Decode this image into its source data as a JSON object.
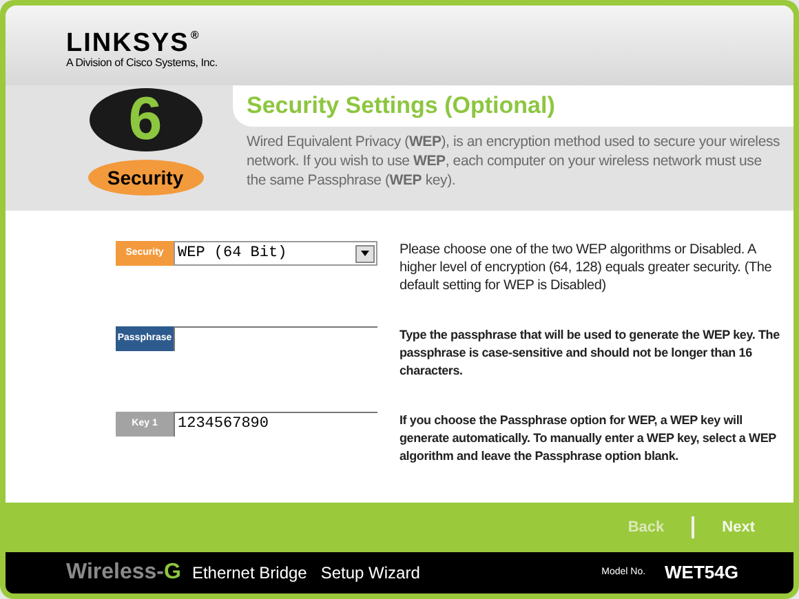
{
  "logo": {
    "name": "LINKSYS",
    "mark": "®",
    "subtitle": "A Division of Cisco Systems, Inc."
  },
  "step": {
    "number": "6",
    "label": "Security"
  },
  "title": "Security Settings (Optional)",
  "intro": "Wired Equivalent Privacy (**WEP**), is an encryption method used to secure your wireless network.  If you wish to use **WEP**, each computer on your wireless network must use the same Passphrase (**WEP** key).",
  "fields": [
    {
      "kind": "select",
      "label": "Security",
      "color": "#f39a3c",
      "value": "WEP (64 Bit)",
      "help": "Please choose one of the two WEP algorithms or Disabled. A higher level of encryption (64, 128) equals greater security. (The default setting for WEP is Disabled)",
      "help_bold": false
    },
    {
      "kind": "text",
      "label": "Passphrase",
      "color": "#2e5b8e",
      "help": "Type the passphrase that will be used to generate the WEP key. The passphrase is case-sensitive and should not be longer than 16 characters.",
      "help_bold": true
    },
    {
      "kind": "text",
      "label": "Key 1",
      "color": "#a3a3a3",
      "value": "1234567890",
      "help": "If you choose the Passphrase option for WEP, a WEP key will generate automatically. To manually enter a WEP key, select a WEP algorithm and leave the Passphrase option blank.",
      "help_bold": true
    }
  ],
  "nav": [
    {
      "label": "Back",
      "disabled": true
    },
    {
      "label": "Next",
      "disabled": false
    }
  ],
  "footer": {
    "brand": "Wireless-",
    "brand_accent": "G",
    "product": "Ethernet Bridge",
    "wizard": "Setup Wizard",
    "model_label": "Model No.",
    "model": "WET54G"
  }
}
